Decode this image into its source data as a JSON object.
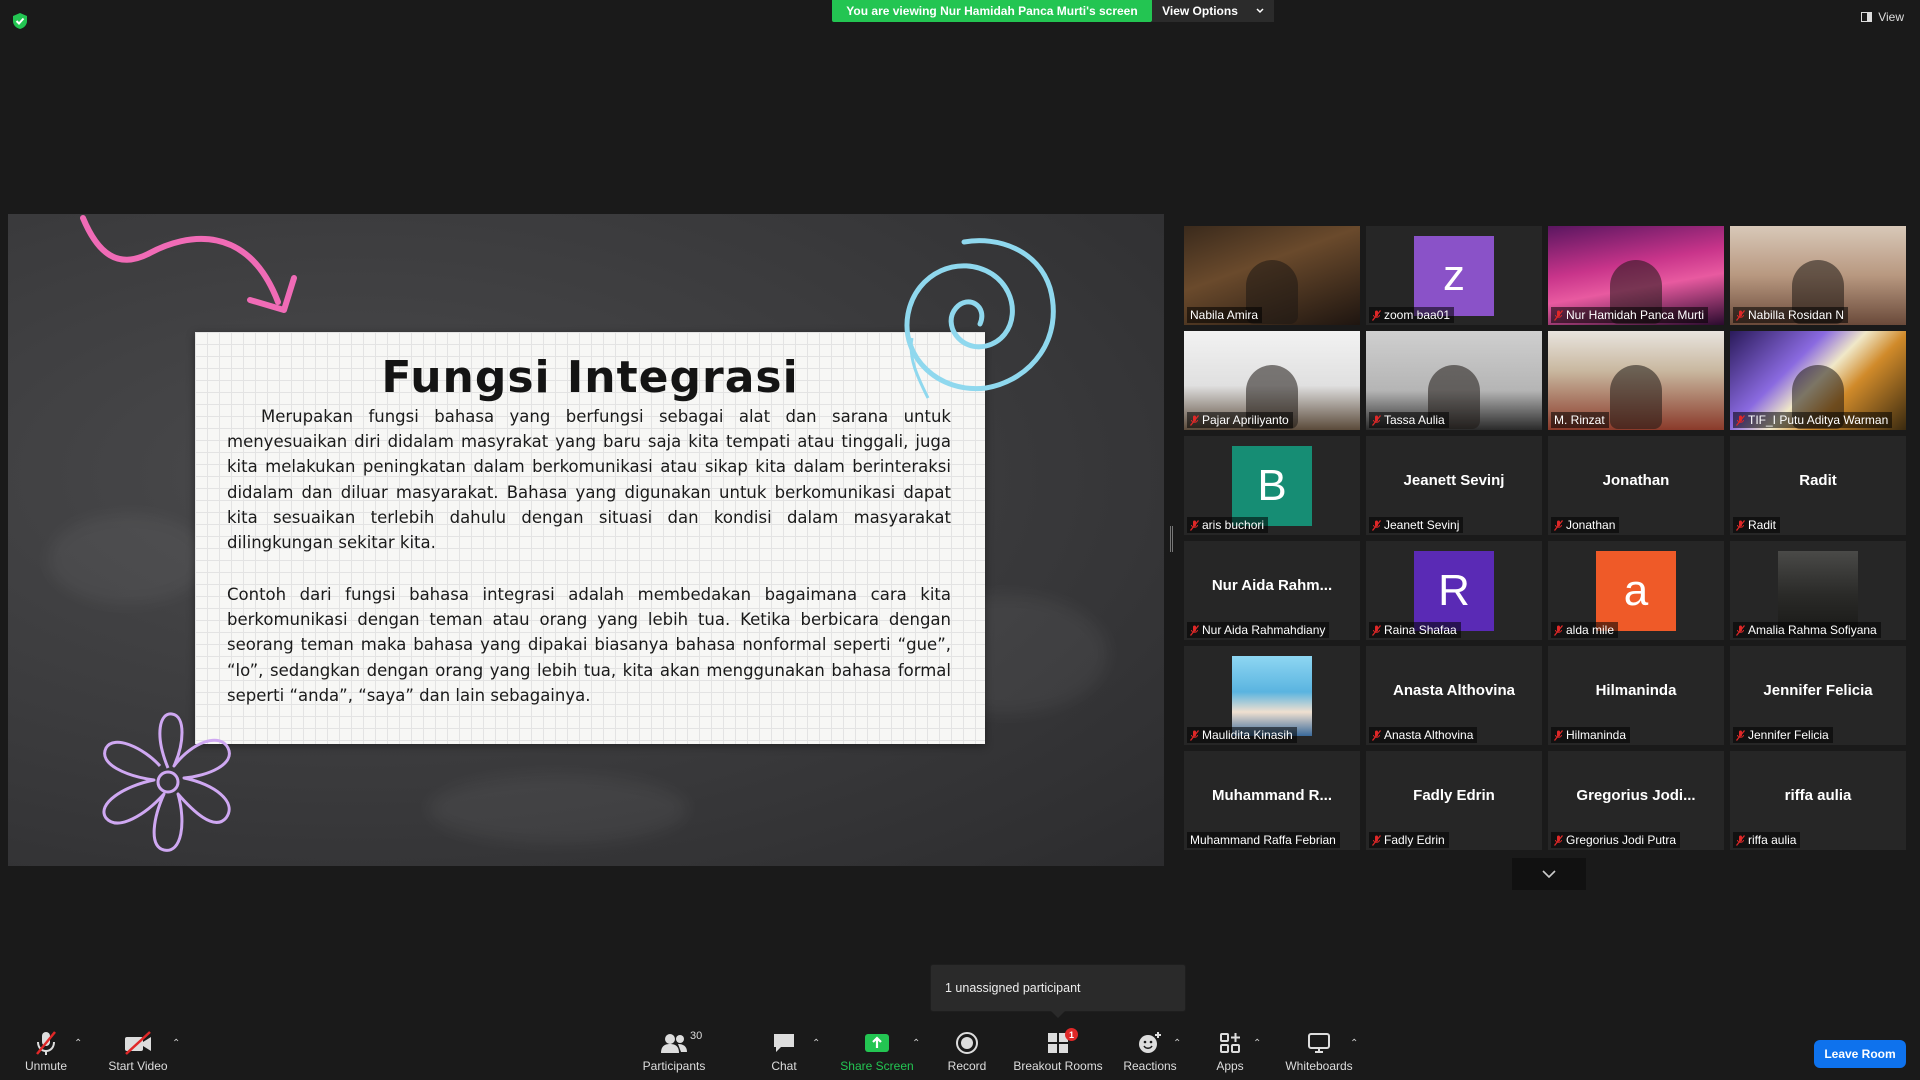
{
  "meeting": {
    "viewing_banner": "You are viewing Nur Hamidah Panca Murti's screen",
    "view_options_label": "View Options",
    "view_label": "View",
    "accent_green": "#23c552",
    "accent_blue": "#0e72ed",
    "active_speaker_color": "#e9e552"
  },
  "slide": {
    "title": "Fungsi Integrasi",
    "paragraph1": "Merupakan fungsi bahasa yang berfungsi sebagai alat dan sarana untuk menyesuaikan diri didalam masyrakat yang baru saja kita tempati atau tinggali, juga kita melakukan peningkatan dalam berkomunikasi atau sikap kita dalam berinteraksi didalam dan diluar masyarakat. Bahasa yang digunakan untuk berkomunikasi dapat kita sesuaikan terlebih dahulu dengan situasi dan kondisi dalam masyarakat dilingkungan sekitar kita.",
    "paragraph2": "Contoh dari fungsi bahasa integrasi adalah membedakan bagaimana cara kita berkomunikasi dengan teman atau orang yang lebih tua. Ketika berbicara dengan seorang teman maka bahasa yang dipakai biasanya bahasa nonformal seperti “gue”, “lo”, sedangkan dengan orang yang lebih tua, kita akan menggunakan bahasa formal seperti “anda”, “saya” dan lain sebagainya."
  },
  "participants": [
    {
      "label": "Nabila Amira",
      "kind": "video",
      "muted": false,
      "active": true
    },
    {
      "label": "zoom baa01",
      "kind": "avatar",
      "initial": "z",
      "color": "#8a52c8",
      "muted": true
    },
    {
      "label": "Nur Hamidah Panca Murti",
      "kind": "video",
      "muted": true
    },
    {
      "label": "Nabilla Rosidan N",
      "kind": "video",
      "muted": true
    },
    {
      "label": "Pajar Apriliyanto",
      "kind": "video",
      "muted": true
    },
    {
      "label": "Tassa Aulia",
      "kind": "video",
      "muted": true
    },
    {
      "label": "M. Rinzat",
      "kind": "video",
      "muted": false
    },
    {
      "label": "TIF_I Putu Aditya Warman",
      "kind": "video",
      "muted": true
    },
    {
      "label": "aris buchori",
      "kind": "avatar",
      "initial": "B",
      "color": "#168d74",
      "muted": true
    },
    {
      "label": "Jeanett Sevinj",
      "kind": "name",
      "display": "Jeanett Sevinj",
      "muted": true
    },
    {
      "label": "Jonathan",
      "kind": "name",
      "display": "Jonathan",
      "muted": true
    },
    {
      "label": "Radit",
      "kind": "name",
      "display": "Radit",
      "muted": true
    },
    {
      "label": "Nur Aida Rahmahdiany",
      "kind": "name",
      "display": "Nur Aida Rahm...",
      "muted": true
    },
    {
      "label": "Raina Shafaa",
      "kind": "avatar",
      "initial": "R",
      "color": "#5a2ab5",
      "muted": true
    },
    {
      "label": "alda mile",
      "kind": "avatar",
      "initial": "a",
      "color": "#ef5a28",
      "muted": true
    },
    {
      "label": "Amalia Rahma Sofiyana",
      "kind": "photo",
      "muted": true
    },
    {
      "label": "Maulidita Kinasih",
      "kind": "photo",
      "muted": true
    },
    {
      "label": "Anasta Althovina",
      "kind": "name",
      "display": "Anasta Althovina",
      "muted": true
    },
    {
      "label": "Hilmaninda",
      "kind": "name",
      "display": "Hilmaninda",
      "muted": true
    },
    {
      "label": "Jennifer Felicia",
      "kind": "name",
      "display": "Jennifer Felicia",
      "muted": true
    },
    {
      "label": "Muhammand Raffa Febrian",
      "kind": "name",
      "display": "Muhammand R...",
      "muted": false
    },
    {
      "label": "Fadly Edrin",
      "kind": "name",
      "display": "Fadly Edrin",
      "muted": true
    },
    {
      "label": "Gregorius Jodi Putra",
      "kind": "name",
      "display": "Gregorius Jodi...",
      "muted": true
    },
    {
      "label": "riffa aulia",
      "kind": "name",
      "display": "riffa aulia",
      "muted": true
    }
  ],
  "tooltip": {
    "text": "1 unassigned participant"
  },
  "toolbar": {
    "unmute": "Unmute",
    "start_video": "Start Video",
    "participants": "Participants",
    "participants_count": "30",
    "chat": "Chat",
    "share_screen": "Share Screen",
    "record": "Record",
    "breakout_rooms": "Breakout Rooms",
    "breakout_badge": "1",
    "reactions": "Reactions",
    "apps": "Apps",
    "whiteboards": "Whiteboards",
    "leave": "Leave Room"
  }
}
